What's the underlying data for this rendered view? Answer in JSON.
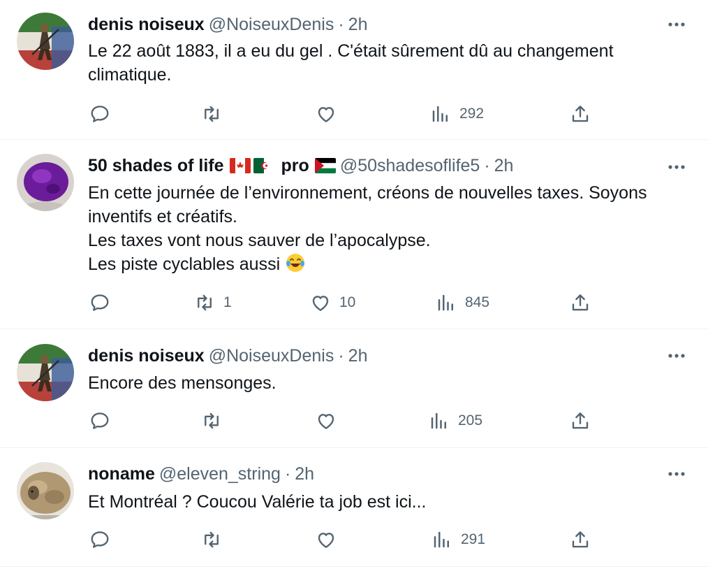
{
  "tweets": [
    {
      "name": "denis noiseux",
      "handle": "@NoiseuxDenis",
      "time": "2h",
      "lines": [
        "Le 22 août 1883, il a eu du gel . C'était sûrement dû au changement",
        "climatique."
      ],
      "replies": "",
      "retweets": "",
      "likes": "",
      "views": "292"
    },
    {
      "name": "50 shades of life",
      "name_suffix": "pro",
      "handle": "@50shadesoflife5",
      "time": "2h",
      "lines": [
        "En cette journée de l’environnement, créons de nouvelles taxes. Soyons",
        "inventifs et créatifs.",
        "Les taxes vont nous sauver de l’apocalypse.",
        "Les piste cyclables aussi"
      ],
      "replies": "",
      "retweets": "1",
      "likes": "10",
      "views": "845"
    },
    {
      "name": "denis noiseux",
      "handle": "@NoiseuxDenis",
      "time": "2h",
      "lines": [
        "Encore des mensonges."
      ],
      "replies": "",
      "retweets": "",
      "likes": "",
      "views": "205"
    },
    {
      "name": "noname",
      "handle": "@eleven_string",
      "time": "2h",
      "lines": [
        "Et Montréal ? Coucou Valérie ta job est ici..."
      ],
      "replies": "",
      "retweets": "",
      "likes": "",
      "views": "291"
    }
  ],
  "icons": {
    "reply": "reply-icon",
    "retweet": "retweet-icon",
    "like": "heart-icon",
    "views": "views-icon",
    "share": "share-icon",
    "more": "more-icon"
  },
  "colors": {
    "text": "#0f1419",
    "secondary": "#536471",
    "divider": "#eff3f4"
  }
}
